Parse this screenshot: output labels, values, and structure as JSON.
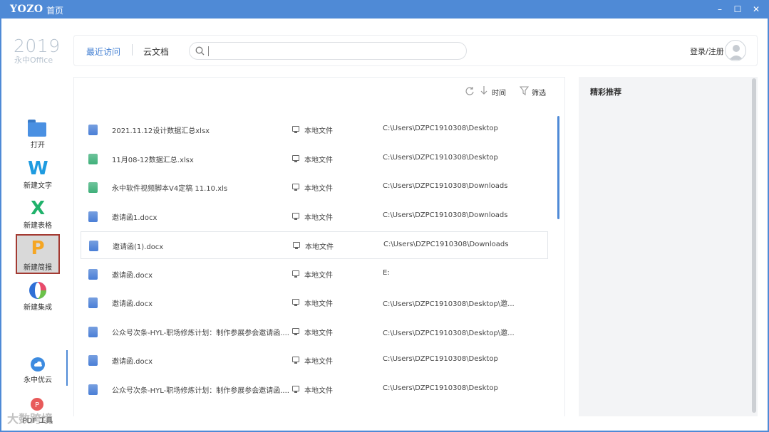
{
  "titlebar": {
    "brand": "YOZO",
    "home": "首页",
    "minimize": "–",
    "maximize": "☐",
    "close": "✕"
  },
  "logo": {
    "year": "2019",
    "subtitle": "永中Office"
  },
  "sidebar": {
    "items": [
      {
        "label": "打开",
        "icon": "folder-icon"
      },
      {
        "label": "新建文字",
        "icon": "writer-w-icon"
      },
      {
        "label": "新建表格",
        "icon": "spreadsheet-x-icon"
      },
      {
        "label": "新建简报",
        "icon": "presentation-p-icon"
      },
      {
        "label": "新建集成",
        "icon": "integration-icon"
      }
    ],
    "cloud": {
      "label": "永中优云",
      "icon": "cloud-icon"
    },
    "pdf": {
      "label": "PDF 工具",
      "icon": "pdf-icon"
    }
  },
  "nav": {
    "tabs": [
      "最近访问",
      "云文档"
    ],
    "search_placeholder": "",
    "login": "登录/注册"
  },
  "toolbar": {
    "sort_label": "时间",
    "filter_label": "筛选"
  },
  "files": [
    {
      "name": "2021.11.12设计数据汇总xlsx",
      "type": "doc",
      "location": "本地文件",
      "path": "C:\\Users\\DZPC1910308\\Desktop"
    },
    {
      "name": "11月08-12数据汇总.xlsx",
      "type": "xls",
      "location": "本地文件",
      "path": "C:\\Users\\DZPC1910308\\Desktop"
    },
    {
      "name": "永中软件视频脚本V4定稿 11.10.xls",
      "type": "xls",
      "location": "本地文件",
      "path": "C:\\Users\\DZPC1910308\\Downloads"
    },
    {
      "name": "邀请函1.docx",
      "type": "doc",
      "location": "本地文件",
      "path": "C:\\Users\\DZPC1910308\\Downloads"
    },
    {
      "name": "邀请函(1).docx",
      "type": "doc",
      "location": "本地文件",
      "path": "C:\\Users\\DZPC1910308\\Downloads"
    },
    {
      "name": "邀请函.docx",
      "type": "doc",
      "location": "本地文件",
      "path": "E:"
    },
    {
      "name": "邀请函.docx",
      "type": "doc",
      "location": "本地文件",
      "path": "C:\\Users\\DZPC1910308\\Desktop\\邀..."
    },
    {
      "name": "公众号次条-HYL-职场修炼计划：制作参展参会邀请函....",
      "type": "doc",
      "location": "本地文件",
      "path": "C:\\Users\\DZPC1910308\\Desktop\\邀..."
    },
    {
      "name": "邀请函.docx",
      "type": "doc",
      "location": "本地文件",
      "path": "C:\\Users\\DZPC1910308\\Desktop"
    },
    {
      "name": "公众号次条-HYL-职场修炼计划：制作参展参会邀请函....",
      "type": "doc",
      "location": "本地文件",
      "path": "C:\\Users\\DZPC1910308\\Desktop"
    }
  ],
  "recommend": {
    "title": "精彩推荐"
  },
  "watermark": "大数跨境",
  "colors": {
    "accent": "#4f8ad6",
    "doc_icon": "#4a7fd6",
    "xls_icon": "#3fb07a",
    "active_border": "#a33a32"
  }
}
